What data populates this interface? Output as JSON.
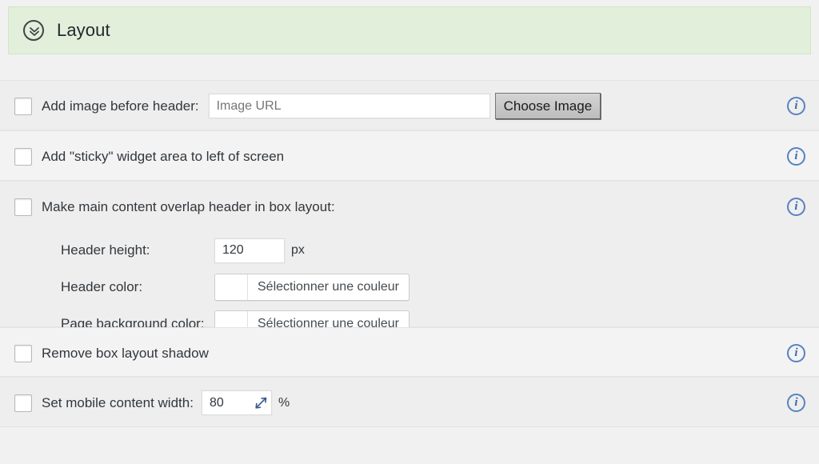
{
  "section": {
    "title": "Layout",
    "toggle_icon": "chevron-double-down-icon",
    "background_color": "#e2efdb"
  },
  "info_icon": {
    "glyph": "i",
    "name": "info-icon",
    "color": "#3b6aa8"
  },
  "rows": [
    {
      "id": "add-image-before-header",
      "label": "Add image before header:",
      "checked": false,
      "input_placeholder": "Image URL",
      "input_value": "",
      "button_label": "Choose Image",
      "has_info": true
    },
    {
      "id": "sticky-widget-area",
      "label": "Add \"sticky\" widget area to left of screen",
      "checked": false,
      "has_info": true
    },
    {
      "id": "main-content-overlap-header",
      "label": "Make main content overlap header in box layout:",
      "checked": false,
      "has_info": true,
      "subfields": [
        {
          "id": "header-height",
          "label": "Header height:",
          "type": "number",
          "value": "120",
          "unit": "px"
        },
        {
          "id": "header-color",
          "label": "Header color:",
          "type": "color",
          "swatch": "#ffffff",
          "button_label": "Sélectionner une couleur"
        },
        {
          "id": "page-background-color",
          "label": "Page background color:",
          "type": "color",
          "swatch": "#ffffff",
          "button_label": "Sélectionner une couleur"
        }
      ]
    },
    {
      "id": "remove-box-layout-shadow",
      "label": "Remove box layout shadow",
      "checked": false,
      "has_info": true
    },
    {
      "id": "set-mobile-content-width",
      "label": "Set mobile content width:",
      "checked": false,
      "input_value": "80",
      "unit": "%",
      "spinner_icon": "resize-arrow-icon",
      "has_info": true
    }
  ]
}
